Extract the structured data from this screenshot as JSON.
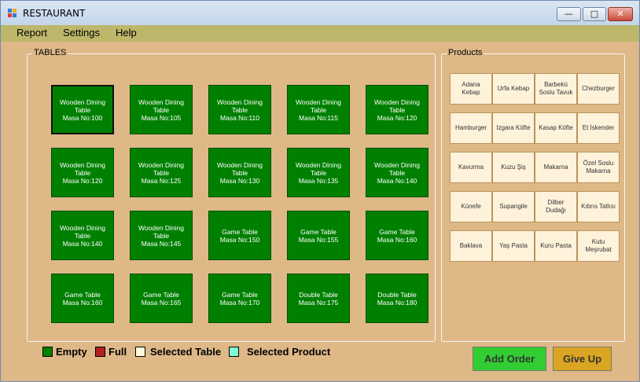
{
  "window": {
    "title": "RESTAURANT"
  },
  "menu": [
    "Report",
    "Settings",
    "Help"
  ],
  "tables_group": {
    "label": "TABLES",
    "tables": [
      {
        "l1": "Wooden Dining",
        "l2": "Table",
        "l3": "Masa No:100"
      },
      {
        "l1": "Wooden Dining",
        "l2": "Table",
        "l3": "Masa No:105"
      },
      {
        "l1": "Wooden Dining",
        "l2": "Table",
        "l3": "Masa No:110"
      },
      {
        "l1": "Wooden Dining",
        "l2": "Table",
        "l3": "Masa No:115"
      },
      {
        "l1": "Wooden Dining",
        "l2": "Table",
        "l3": "Masa No:120"
      },
      {
        "l1": "Wooden Dining",
        "l2": "Table",
        "l3": "Masa No:120"
      },
      {
        "l1": "Wooden Dining",
        "l2": "Table",
        "l3": "Masa No:125"
      },
      {
        "l1": "Wooden Dining",
        "l2": "Table",
        "l3": "Masa No:130"
      },
      {
        "l1": "Wooden Dining",
        "l2": "Table",
        "l3": "Masa No:135"
      },
      {
        "l1": "Wooden Dining",
        "l2": "Table",
        "l3": "Masa No:140"
      },
      {
        "l1": "Wooden Dining",
        "l2": "Table",
        "l3": "Masa No:140"
      },
      {
        "l1": "Wooden Dining",
        "l2": "Table",
        "l3": "Masa No:145"
      },
      {
        "l1": "Game Table",
        "l2": "",
        "l3": "Masa No:150"
      },
      {
        "l1": "Game Table",
        "l2": "",
        "l3": "Masa No:155"
      },
      {
        "l1": "Game Table",
        "l2": "",
        "l3": "Masa No:160"
      },
      {
        "l1": "Game Table",
        "l2": "",
        "l3": "Masa No:160"
      },
      {
        "l1": "Game Table",
        "l2": "",
        "l3": "Masa No:165"
      },
      {
        "l1": "Game Table",
        "l2": "",
        "l3": "Masa No:170"
      },
      {
        "l1": "Double Table",
        "l2": "",
        "l3": "Masa No:175"
      },
      {
        "l1": "Double Table",
        "l2": "",
        "l3": "Masa No:180"
      }
    ]
  },
  "products_group": {
    "label": "Products",
    "products": [
      "Adana Kebap",
      "Urfa Kebap",
      "Barbekü Soslu Tavuk",
      "Chezburger",
      "Hamburger",
      "Izgara Köfte",
      "Kasap Köfte",
      "Et İskender",
      "Kavurma",
      "Kuzu Şiş",
      "Makarna",
      "Özel Soslu Makarna",
      "Künefe",
      "Supangile",
      "Dilber Dudağı",
      "Kıbrıs Tatlısı",
      "Baklava",
      "Yaş Pasta",
      "Kuru Pasta",
      "Kutu Meşrubat"
    ]
  },
  "legend": {
    "empty": "Empty",
    "full": "Full",
    "selected_table": "Selected Table",
    "selected_product": "Selected Product"
  },
  "colors": {
    "empty": "#008000",
    "full": "#b22222",
    "selected_table": "#fff8dc",
    "selected_product": "#7fffd4",
    "background": "#deb887",
    "menubar": "#bdb76b",
    "add_order": "#32cd32",
    "give_up": "#daa520"
  },
  "buttons": {
    "add_order": "Add Order",
    "give_up": "Give Up"
  },
  "state": {
    "selected_table_index": 0
  }
}
